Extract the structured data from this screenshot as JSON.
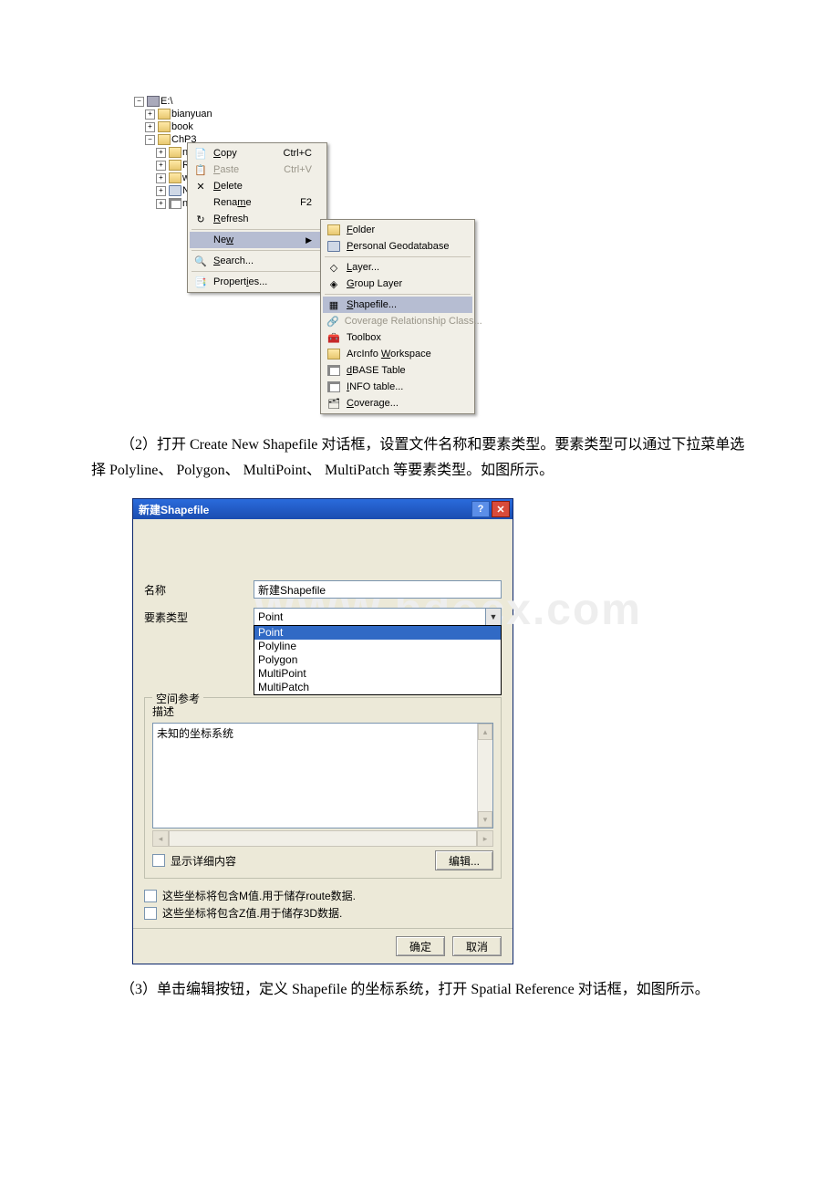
{
  "tree": {
    "root": "E:\\",
    "items": [
      "bianyuan",
      "book",
      "ChP3",
      "ne",
      "Re",
      "we",
      "Ne",
      "ne"
    ]
  },
  "context_menu": {
    "copy": {
      "label": "Copy",
      "shortcut": "Ctrl+C"
    },
    "paste": {
      "label": "Paste",
      "shortcut": "Ctrl+V"
    },
    "delete": {
      "label": "Delete"
    },
    "rename": {
      "label": "Rename",
      "shortcut": "F2"
    },
    "refresh": {
      "label": "Refresh"
    },
    "new": {
      "label": "New"
    },
    "search": {
      "label": "Search..."
    },
    "properties": {
      "label": "Properties..."
    }
  },
  "new_submenu": {
    "folder": "Folder",
    "pgdb": "Personal Geodatabase",
    "layer": "Layer...",
    "group_layer": "Group Layer",
    "shapefile": "Shapefile...",
    "cov_rel": "Coverage Relationship Class...",
    "toolbox": "Toolbox",
    "arcinfo_ws": "ArcInfo Workspace",
    "dbase": "dBASE Table",
    "info_table": "INFO table...",
    "coverage": "Coverage..."
  },
  "paragraph2": "（2）打开 Create New Shapefile 对话框，设置文件名称和要素类型。要素类型可以通过下拉菜单选择 Polyline、 Polygon、 MultiPoint、 MultiPatch 等要素类型。如图所示。",
  "dialog": {
    "title": "新建Shapefile",
    "name_label": "名称",
    "name_value": "新建Shapefile",
    "type_label": "要素类型",
    "type_value": "Point",
    "type_options": [
      "Point",
      "Polyline",
      "Polygon",
      "MultiPoint",
      "MultiPatch"
    ],
    "spatial_ref_legend": "空间参考",
    "desc_label": "描述",
    "unknown_sys": "未知的坐标系统",
    "show_detail": "显示详细内容",
    "edit_btn": "编辑...",
    "chk_m": "这些坐标将包含M值.用于储存route数据.",
    "chk_z": "这些坐标将包含Z值.用于储存3D数据.",
    "ok": "确定",
    "cancel": "取消"
  },
  "watermark": "WWW.bdocx.com",
  "paragraph3": "（3）单击编辑按钮，定义 Shapefile 的坐标系统，打开 Spatial Reference 对话框，如图所示。"
}
